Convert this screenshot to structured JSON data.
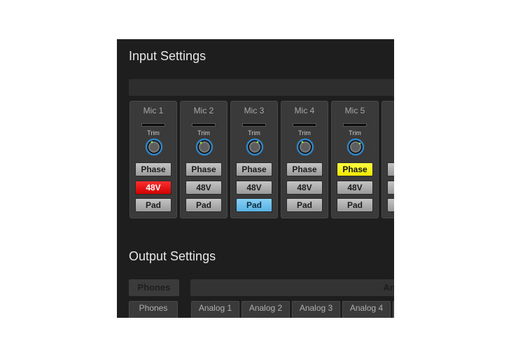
{
  "input_settings": {
    "title": "Input Settings",
    "trim_label": "Trim",
    "channels": [
      {
        "name": "Mic 1",
        "phase": "Phase",
        "v48": "48V",
        "pad": "Pad"
      },
      {
        "name": "Mic 2",
        "phase": "Phase",
        "v48": "48V",
        "pad": "Pad"
      },
      {
        "name": "Mic 3",
        "phase": "Phase",
        "v48": "48V",
        "pad": "Pad"
      },
      {
        "name": "Mic 4",
        "phase": "Phase",
        "v48": "48V",
        "pad": "Pad"
      },
      {
        "name": "Mic 5",
        "phase": "Phase",
        "v48": "48V",
        "pad": "Pad"
      }
    ],
    "active_states": {
      "mic1_48v": true,
      "mic3_pad": true,
      "mic5_phase": true
    }
  },
  "output_settings": {
    "title": "Output Settings",
    "phones_header": "Phones",
    "analog_header": "Ana",
    "tabs": [
      "Phones",
      "Analog 1",
      "Analog 2",
      "Analog 3",
      "Analog 4"
    ]
  },
  "colors": {
    "panel_bg": "#1e1e1e",
    "active_48v": "#e00000",
    "active_phase": "#f5f000",
    "active_pad": "#6cc0ec",
    "knob_ring": "#2f86c8"
  },
  "icons": {
    "trim_knob": "trim-knob-icon"
  }
}
